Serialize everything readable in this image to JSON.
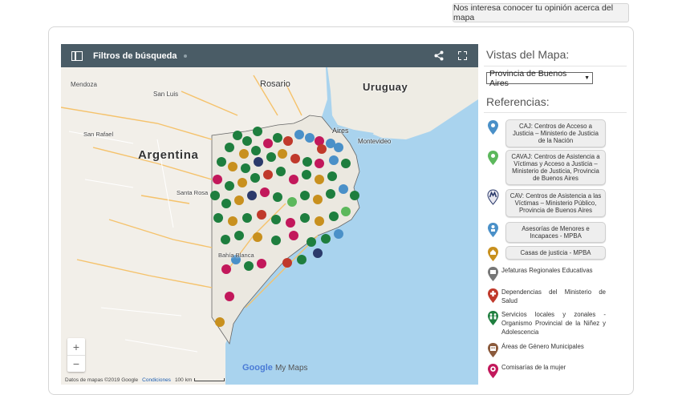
{
  "feedback_button": "Nos interesa conocer tu opinión acerca del mapa",
  "map": {
    "title": "Filtros de búsqueda",
    "labels": {
      "rosario": "Rosario",
      "uruguay": "Uruguay",
      "mendoza": "Mendoza",
      "san_luis": "San Luis",
      "san_rafael": "San Rafael",
      "argentina": "Argentina",
      "aires": "Aires",
      "montevideo": "Montevideo",
      "santa_rosa": "Santa Rosa",
      "bahia_blanca": "Bahía Blanca"
    },
    "zoom_in": "+",
    "zoom_out": "−",
    "footer_data": "Datos de mapas ©2019 Google",
    "footer_terms": "Condiciones",
    "footer_scale": "100 km",
    "logo_google": "Google",
    "logo_mymaps": "My Maps"
  },
  "vistas": {
    "title": "Vistas del Mapa:",
    "selected": "Provincia de Buenos Aires"
  },
  "referencias": {
    "title": "Referencias:",
    "items": [
      {
        "label": "CAJ: Centros de Acceso a Justicia – Ministerio de Justicia de la Nación",
        "color": "#4a90c8",
        "icon": "blue-pin-icon"
      },
      {
        "label": "CAVAJ: Centros de Asistencia a Víctimas y Acceso a Justicia – Ministerio de Justicia, Provincia de Buenos Aires",
        "color": "#5cb85c",
        "icon": "green-pin-icon"
      },
      {
        "label": "CAV: Centros de Asistencia a las Víctimas – Ministerio Público, Provincia de Buenos Aires",
        "color": "#2b3a6b",
        "icon": "cav-pin-icon"
      },
      {
        "label": "Asesorías de Menores e Incapaces - MPBA",
        "color": "#4a90c8",
        "icon": "asesoria-pin-icon"
      },
      {
        "label": "Casas de justicia - MPBA",
        "color": "#c8901e",
        "icon": "casa-justicia-pin-icon"
      },
      {
        "label": "Jefaturas Regionales Educativas",
        "color": "#777777",
        "icon": "jefatura-pin-icon"
      },
      {
        "label": "Dependencias del Ministerio de Salud",
        "color": "#c0392b",
        "icon": "salud-pin-icon"
      },
      {
        "label": "Servicios locales y zonales - Organismo Provincial de la Niñez y Adolescencia",
        "color": "#1e7e3e",
        "icon": "ninez-pin-icon"
      },
      {
        "label": "Áreas de Género Municipales",
        "color": "#8b5a3c",
        "icon": "genero-pin-icon"
      },
      {
        "label": "Comisarías de la mujer",
        "color": "#c2185b",
        "icon": "comisaria-pin-icon"
      }
    ]
  }
}
